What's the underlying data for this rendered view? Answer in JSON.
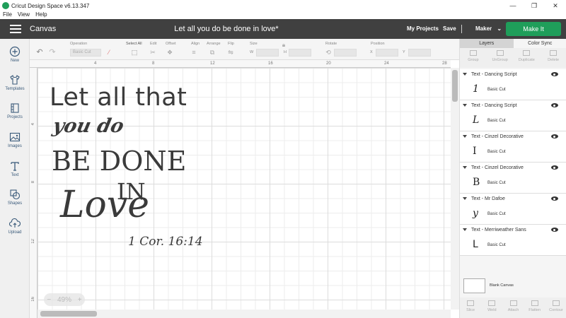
{
  "window": {
    "title": "Cricut Design Space  v6.13.347",
    "controls": [
      "—",
      "❐",
      "✕"
    ]
  },
  "menu": [
    "File",
    "View",
    "Help"
  ],
  "header": {
    "section": "Canvas",
    "project_title": "Let all you do be done in love*",
    "my_projects": "My Projects",
    "save": "Save",
    "machine": "Maker",
    "make_it": "Make It",
    "accent": "#1f9e5a"
  },
  "sidebar": {
    "items": [
      {
        "label": "New",
        "icon": "plus-circle-icon"
      },
      {
        "label": "Templates",
        "icon": "shirt-icon"
      },
      {
        "label": "Projects",
        "icon": "projects-icon"
      },
      {
        "label": "Images",
        "icon": "image-icon"
      },
      {
        "label": "Text",
        "icon": "text-icon"
      },
      {
        "label": "Shapes",
        "icon": "shapes-icon"
      },
      {
        "label": "Upload",
        "icon": "upload-icon"
      }
    ]
  },
  "toolbar": {
    "operation_label": "Operation",
    "operation_value": "Basic Cut",
    "select_all": "Select All",
    "edit": "Edit",
    "offset": "Offset",
    "align": "Align",
    "arrange": "Arrange",
    "flip": "Flip",
    "size": "Size",
    "size_w": "W",
    "size_h": "H",
    "rotate": "Rotate",
    "position": "Position",
    "pos_x": "X",
    "pos_y": "Y"
  },
  "ruler": {
    "top": [
      "4",
      "8",
      "12",
      "16",
      "20",
      "24",
      "28"
    ],
    "left": [
      "4",
      "8",
      "12",
      "16"
    ]
  },
  "zoom": {
    "minus": "−",
    "value": "49%",
    "plus": "+"
  },
  "design": {
    "line1": "Let all that",
    "line2": "you do",
    "line3": "BE DONE",
    "line4": "IN",
    "line5": "Love",
    "line6": "1 Cor. 16:14"
  },
  "panel": {
    "tabs": [
      "Layers",
      "Color Sync"
    ],
    "top_tools": [
      "Group",
      "UnGroup",
      "Duplicate",
      "Delete"
    ],
    "layers": [
      {
        "name": "Text - Dancing Script",
        "glyph": "1",
        "operation": "Basic Cut"
      },
      {
        "name": "Text - Dancing Script",
        "glyph": "L",
        "operation": "Basic Cut"
      },
      {
        "name": "Text - Cinzel Decorative",
        "glyph": "I",
        "operation": "Basic Cut"
      },
      {
        "name": "Text - Cinzel Decorative",
        "glyph": "B",
        "operation": "Basic Cut"
      },
      {
        "name": "Text - Mr Dafoe",
        "glyph": "y",
        "operation": "Basic Cut"
      },
      {
        "name": "Text - Merriweather Sans",
        "glyph": "L",
        "operation": "Basic Cut"
      }
    ],
    "blank_canvas": "Blank Canvas",
    "bottom_tools": [
      "Slice",
      "Weld",
      "Attach",
      "Flatten",
      "Contour"
    ]
  }
}
